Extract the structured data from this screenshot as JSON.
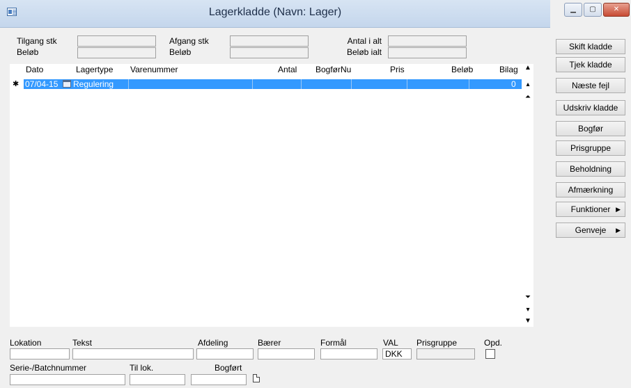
{
  "window": {
    "title": "Lagerkladde (Navn: Lager)"
  },
  "summary": {
    "tilgang_stk": "Tilgang stk",
    "belob1": "Beløb",
    "afgang_stk": "Afgang stk",
    "belob2": "Beløb",
    "antal_i_alt": "Antal i alt",
    "belob_ialt": "Beløb ialt"
  },
  "grid": {
    "columns": [
      "Dato",
      "Lagertype",
      "Varenummer",
      "Antal",
      "BogførNu",
      "Pris",
      "Beløb",
      "Bilag"
    ],
    "rows": [
      {
        "marker": "✱",
        "dato": "07/04-15",
        "lagertype": "Regulering",
        "bilag": "0"
      }
    ]
  },
  "side_buttons": {
    "skift": "Skift kladde",
    "tjek": "Tjek kladde",
    "naeste": "Næste fejl",
    "udskriv": "Udskriv kladde",
    "bogfor": "Bogfør",
    "prisgruppe": "Prisgruppe",
    "beholdning": "Beholdning",
    "afmaerkning": "Afmærkning",
    "funktioner": "Funktioner",
    "genveje": "Genveje"
  },
  "bottom": {
    "lokation": "Lokation",
    "tekst": "Tekst",
    "afdeling": "Afdeling",
    "baerer": "Bærer",
    "formal": "Formål",
    "val": "VAL",
    "val_value": "DKK",
    "prisgruppe": "Prisgruppe",
    "opd": "Opd.",
    "serie": "Serie-/Batchnummer",
    "til_lok": "Til lok.",
    "bogfort": "Bogført"
  },
  "colors": {
    "selection": "#3399ff",
    "titlebar": "#c4d6ec"
  },
  "icons": [
    "window-icon",
    "calendar-icon",
    "scroll-up-icon",
    "scroll-down-icon",
    "attachment-icon"
  ]
}
